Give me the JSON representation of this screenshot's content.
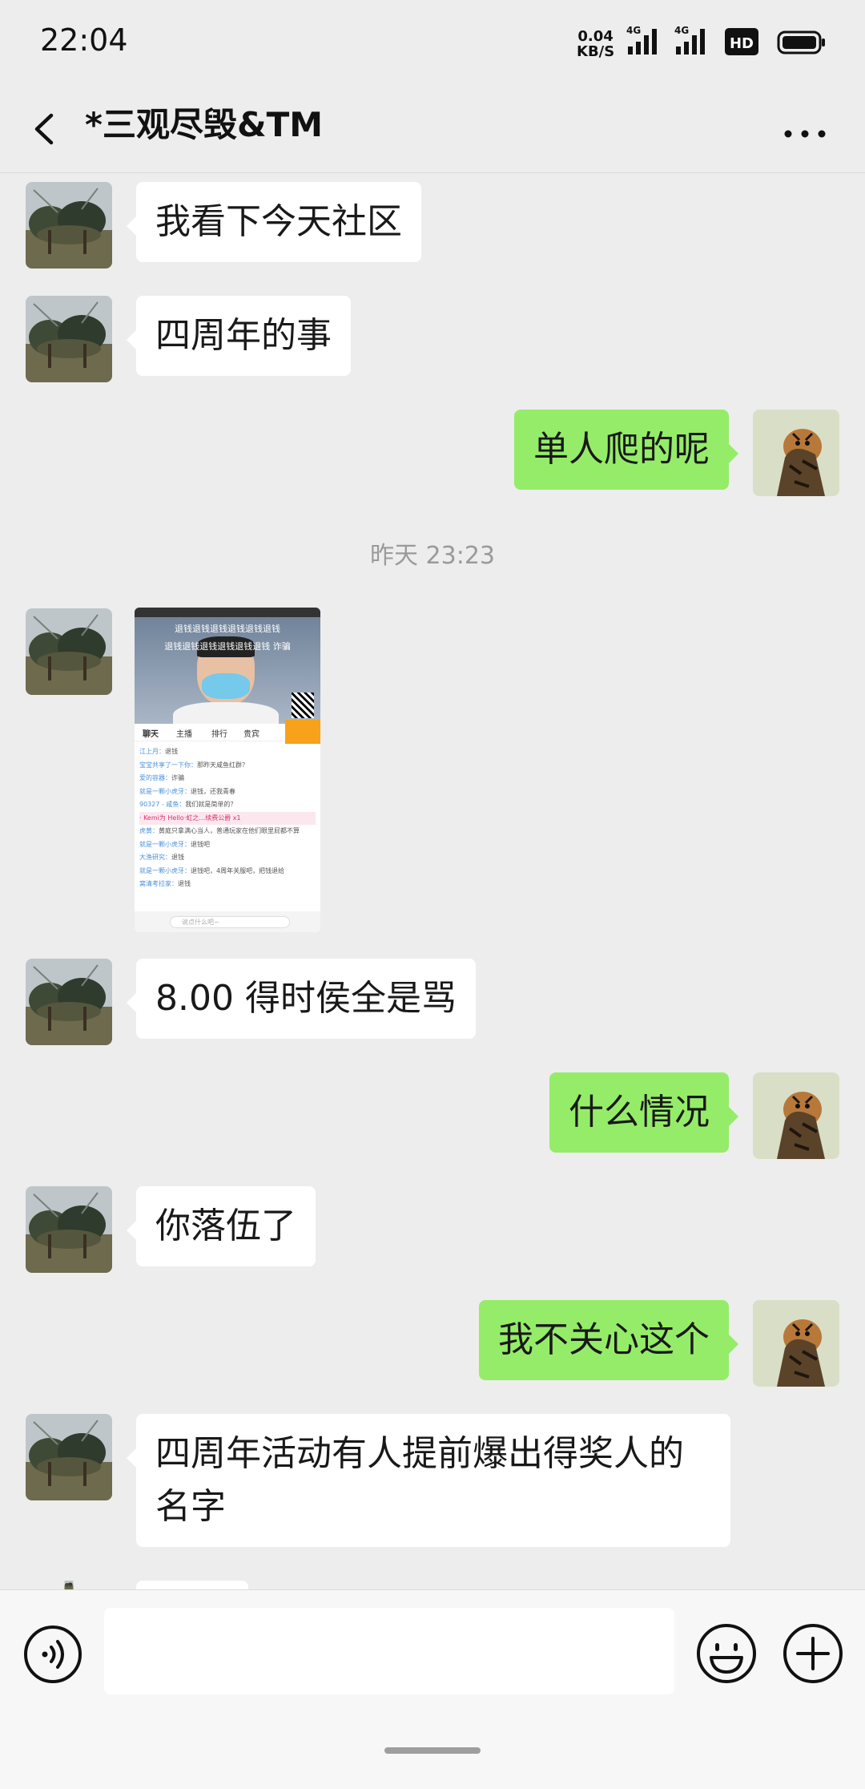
{
  "status_bar": {
    "time": "22:04",
    "net_speed_value": "0.04",
    "net_speed_unit": "KB/S",
    "signal_1": "4G",
    "signal_2": "4G",
    "hd_badge": "HD"
  },
  "header": {
    "title": "*三观尽毁&TM"
  },
  "messages": [
    {
      "side": "in",
      "text": "我看下今天社区"
    },
    {
      "side": "in",
      "text": "四周年的事"
    },
    {
      "side": "out",
      "text": "单人爬的呢"
    },
    {
      "side": "in",
      "text": "8.00 得时侯全是骂"
    },
    {
      "side": "out",
      "text": "什么情况"
    },
    {
      "side": "in",
      "text": "你落伍了"
    },
    {
      "side": "out",
      "text": "我不关心这个"
    },
    {
      "side": "in",
      "text": "四周年活动有人提前爆出得奖人的名字"
    }
  ],
  "timestamp": "昨天 23:23",
  "image_message": {
    "overlay_line1": "退钱退钱退钱退钱退钱退钱",
    "overlay_line2": "退钱退钱退钱退钱退钱退钱 诈骗",
    "tabs": [
      "聊天",
      "主播",
      "排行",
      "贵宾"
    ],
    "chat_lines": [
      {
        "name": "江上月：",
        "text": "退钱"
      },
      {
        "name": "宝宝共享了一下你：",
        "text": "那昨天咸鱼红群？"
      },
      {
        "name": "爱的容器：",
        "text": "诈骗"
      },
      {
        "name": "就是一颗小虎牙：",
        "text": "退钱，还我青春"
      },
      {
        "name": "90327 - 咸鱼：",
        "text": "我们就是简单的？"
      },
      {
        "name": "· Kemi为 Hello·虹之…续费",
        "text": "公爵 x1"
      },
      {
        "name": "虎黄：",
        "text": "黄庭只拿满心当人，普通玩家在他们眼里屁都不算"
      },
      {
        "name": "就是一颗小虎牙：",
        "text": "退钱吧"
      },
      {
        "name": "大渔研究：",
        "text": "退钱"
      },
      {
        "name": "就是一颗小虎牙：",
        "text": "退钱吧，4周年关服吧，把钱退给"
      },
      {
        "name": "窝清考拉家：",
        "text": "退钱"
      }
    ],
    "input_placeholder": "说点什么吧~"
  },
  "colors": {
    "background": "#EDEDED",
    "bubble_in": "#FFFFFF",
    "bubble_out": "#95EC69"
  },
  "icons": {
    "back": "chevron-left-icon",
    "more": "more-horizontal-icon",
    "voice": "voice-icon",
    "emoji": "emoji-icon",
    "plus": "plus-icon"
  }
}
